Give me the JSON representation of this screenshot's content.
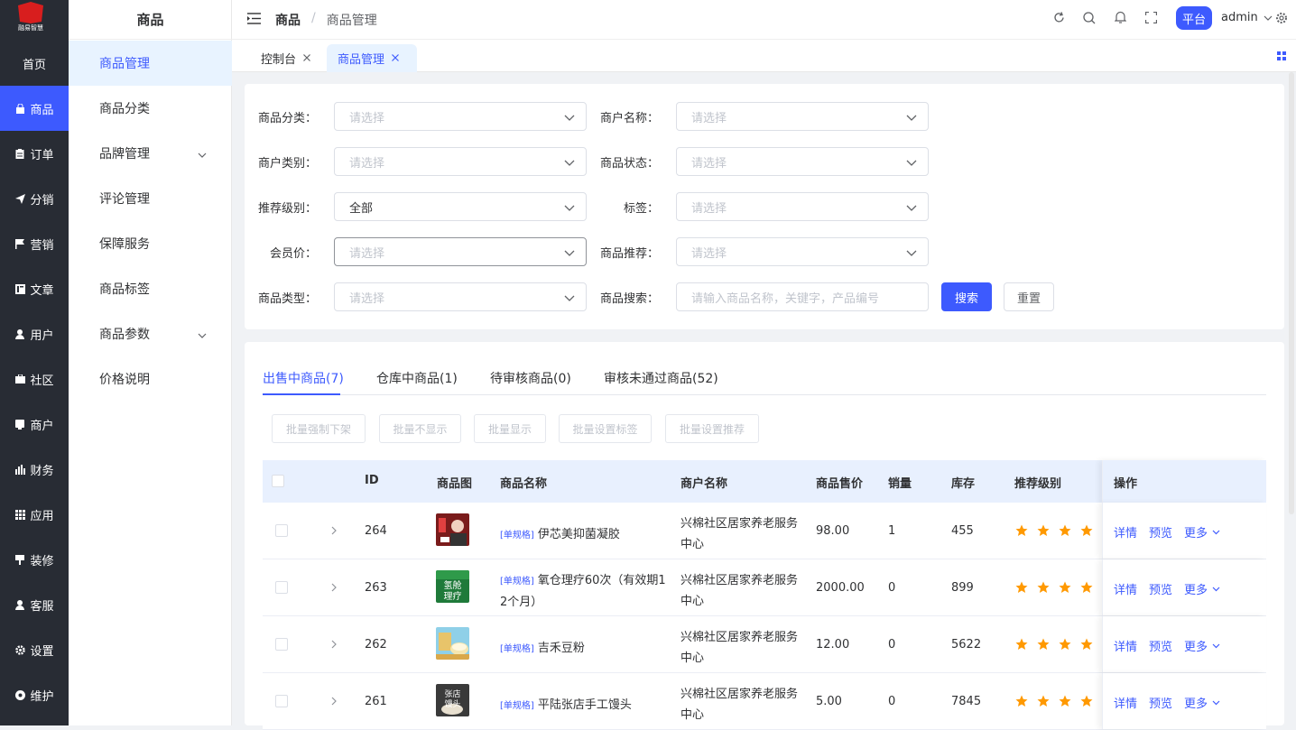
{
  "rail": {
    "logo_text": "融易智慧",
    "items": [
      {
        "label": "首页",
        "icon": "home-icon"
      },
      {
        "label": "商品",
        "icon": "bag-icon"
      },
      {
        "label": "订单",
        "icon": "clipboard-icon"
      },
      {
        "label": "分销",
        "icon": "send-icon"
      },
      {
        "label": "营销",
        "icon": "flag-icon"
      },
      {
        "label": "文章",
        "icon": "article-icon"
      },
      {
        "label": "用户",
        "icon": "user-icon"
      },
      {
        "label": "社区",
        "icon": "briefcase-icon"
      },
      {
        "label": "商户",
        "icon": "store-icon"
      },
      {
        "label": "财务",
        "icon": "bar-chart-icon"
      },
      {
        "label": "应用",
        "icon": "grid-icon"
      },
      {
        "label": "装修",
        "icon": "brush-icon"
      },
      {
        "label": "客服",
        "icon": "support-icon"
      },
      {
        "label": "设置",
        "icon": "gear-icon"
      },
      {
        "label": "维护",
        "icon": "maintenance-icon"
      }
    ],
    "active_index": 1,
    "active_color": "#3d5afe"
  },
  "submenu": {
    "title": "商品",
    "items": [
      {
        "label": "商品管理",
        "expandable": false
      },
      {
        "label": "商品分类",
        "expandable": false
      },
      {
        "label": "品牌管理",
        "expandable": true
      },
      {
        "label": "评论管理",
        "expandable": false
      },
      {
        "label": "保障服务",
        "expandable": false
      },
      {
        "label": "商品标签",
        "expandable": false
      },
      {
        "label": "商品参数",
        "expandable": true
      },
      {
        "label": "价格说明",
        "expandable": false
      }
    ]
  },
  "header": {
    "breadcrumb_root": "商品",
    "breadcrumb_sep": "/",
    "breadcrumb_current": "商品管理",
    "platform_badge": "平台",
    "user": "admin"
  },
  "tabs": [
    {
      "label": "控制台",
      "active": false
    },
    {
      "label": "商品管理",
      "active": true
    }
  ],
  "filter": {
    "category": {
      "label": "商品分类：",
      "value": "",
      "placeholder": "请选择"
    },
    "merchant_name": {
      "label": "商户名称：",
      "value": "",
      "placeholder": "请选择"
    },
    "merchant_type": {
      "label": "商户类别：",
      "value": "",
      "placeholder": "请选择"
    },
    "status": {
      "label": "商品状态：",
      "value": "",
      "placeholder": "请选择"
    },
    "recommend_level": {
      "label": "推荐级别：",
      "value": "全部",
      "placeholder": "请选择"
    },
    "tag": {
      "label": "标签：",
      "value": "",
      "placeholder": "请选择"
    },
    "member_price": {
      "label": "会员价：",
      "value": "",
      "placeholder": "请选择"
    },
    "recommend": {
      "label": "商品推荐：",
      "value": "",
      "placeholder": "请选择"
    },
    "goods_type": {
      "label": "商品类型：",
      "value": "",
      "placeholder": "请选择"
    },
    "search": {
      "label": "商品搜索：",
      "value": "",
      "placeholder": "请输入商品名称，关键字，产品编号"
    },
    "search_button": "搜索",
    "reset_button": "重置"
  },
  "panel": {
    "tabs": [
      "出售中商品(7)",
      "仓库中商品(1)",
      "待审核商品(0)",
      "审核未通过商品(52)"
    ],
    "active_tab": 0,
    "batch_buttons": [
      "批量强制下架",
      "批量不显示",
      "批量显示",
      "批量设置标签",
      "批量设置推荐"
    ],
    "columns": {
      "id": "ID",
      "image": "商品图",
      "name": "商品名称",
      "merchant": "商户名称",
      "price": "商品售价",
      "sales": "销量",
      "stock": "库存",
      "level": "推荐级别",
      "ops": "操作"
    },
    "rows": [
      {
        "id": "264",
        "tag": "[单规格]",
        "name": "伊芯美抑菌凝胶",
        "merchant_line1": "兴棉社区居家养老服务",
        "merchant_line2": "中心",
        "price": "98.00",
        "sales": "1",
        "stock": "455",
        "stars": 4,
        "thumb_color": "#7a1b1b"
      },
      {
        "id": "263",
        "tag": "[单规格]",
        "name_line1": "氧仓理疗60次（有效期1",
        "name_line2": "2个月）",
        "merchant_line1": "兴棉社区居家养老服务",
        "merchant_line2": "中心",
        "price": "2000.00",
        "sales": "0",
        "stock": "899",
        "stars": 4,
        "thumb_color": "#1f7a3a",
        "thumb_text": "氢舱理疗"
      },
      {
        "id": "262",
        "tag": "[单规格]",
        "name": "吉禾豆粉",
        "merchant_line1": "兴棉社区居家养老服务",
        "merchant_line2": "中心",
        "price": "12.00",
        "sales": "0",
        "stock": "5622",
        "stars": 4,
        "thumb_color": "#e8c46a"
      },
      {
        "id": "261",
        "tag": "[单规格]",
        "name": "平陆张店手工馒头",
        "merchant_line1": "兴棉社区居家养老服务",
        "merchant_line2": "中心",
        "price": "5.00",
        "sales": "0",
        "stock": "7845",
        "stars": 4,
        "thumb_color": "#3a3a3a",
        "thumb_text": "张店馒头"
      }
    ],
    "ops": {
      "detail": "详情",
      "preview": "预览",
      "more": "更多"
    }
  }
}
